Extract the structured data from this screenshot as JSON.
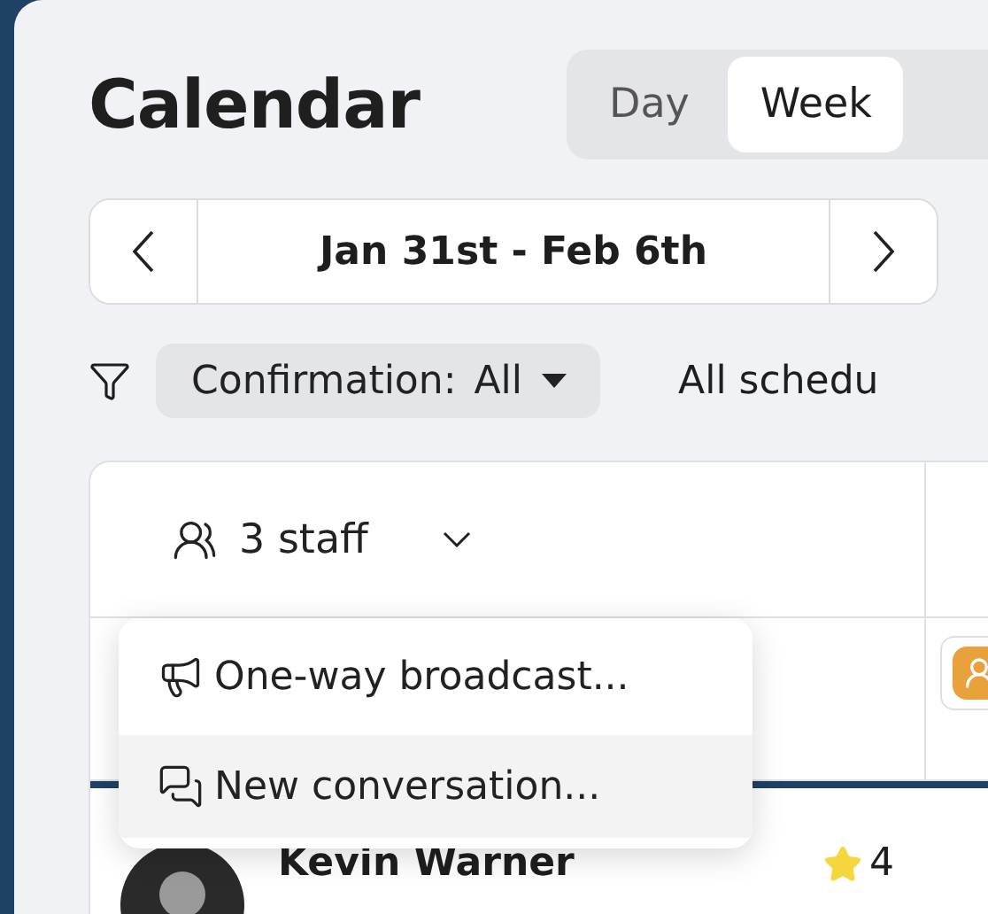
{
  "title": "Calendar",
  "view_tabs": [
    {
      "label": "Day",
      "selected": false
    },
    {
      "label": "Week",
      "selected": true
    }
  ],
  "date_range": {
    "label": "Jan 31st - Feb 6th"
  },
  "filters": [
    {
      "label": "Confirmation:",
      "value": "All"
    }
  ],
  "schedule_filter": "All schedu",
  "staff_column": {
    "label": "3 staff"
  },
  "menu": [
    {
      "kind": "broadcast",
      "label": "One-way broadcast...",
      "highlighted": false
    },
    {
      "kind": "conversation",
      "label": "New conversation...",
      "highlighted": true
    }
  ],
  "staff": [
    {
      "name": "Kevin Warner",
      "rating": "4"
    }
  ]
}
